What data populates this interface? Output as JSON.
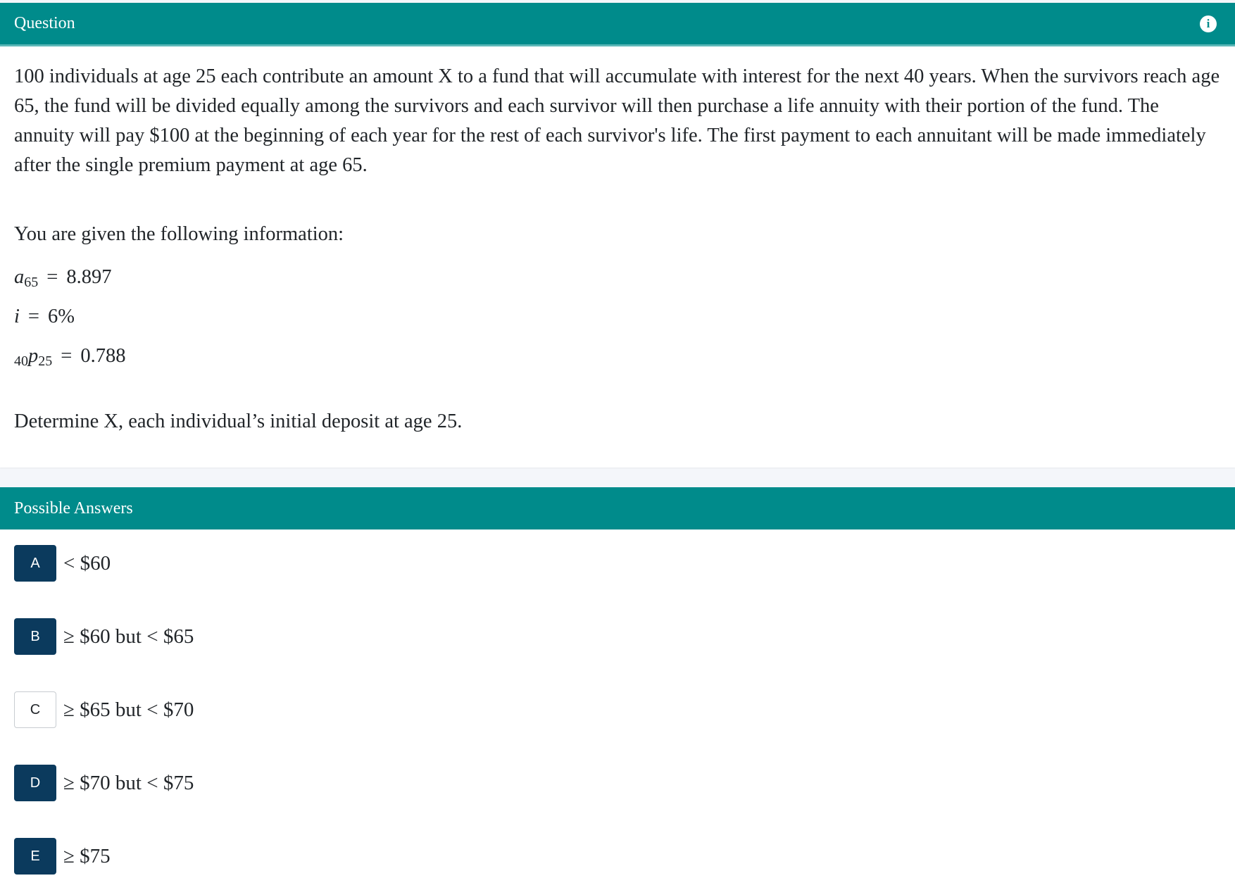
{
  "question_panel": {
    "header_title": "Question",
    "info_icon": "info-icon",
    "intro": "100 individuals at age 25 each contribute an amount X to a fund that will accumulate with interest for the next 40 years. When the survivors reach age 65, the fund will be divided equally among the survivors and each survivor will then purchase a life annuity with their portion of the fund. The annuity will pay $100 at the beginning of each year for the rest of each survivor's life. The first payment to each annuitant will be made immediately after the single premium payment at age 65.",
    "given_heading": "You are given the following information:",
    "given": [
      {
        "symbol": "a",
        "pre_sub": "",
        "sub": "65",
        "value": "8.897"
      },
      {
        "symbol": "i",
        "pre_sub": "",
        "sub": "",
        "value": "6%"
      },
      {
        "symbol": "p",
        "pre_sub": "40",
        "sub": "25",
        "value": "0.788"
      }
    ],
    "determine": "Determine X, each individual’s initial deposit at age 25."
  },
  "answers_panel": {
    "header_title": "Possible Answers",
    "answers": [
      {
        "letter": "A",
        "text": "< $60",
        "style": "filled"
      },
      {
        "letter": "B",
        "text": "≥ $60 but < $65",
        "style": "filled"
      },
      {
        "letter": "C",
        "text": "≥ $65 but < $70",
        "style": "outline"
      },
      {
        "letter": "D",
        "text": "≥ $70 but < $75",
        "style": "filled"
      },
      {
        "letter": "E",
        "text": "≥ $75",
        "style": "filled"
      }
    ]
  },
  "colors": {
    "header_bg": "#008b8b",
    "badge_bg": "#0b3a5d",
    "page_bg": "#f4f6fa"
  }
}
